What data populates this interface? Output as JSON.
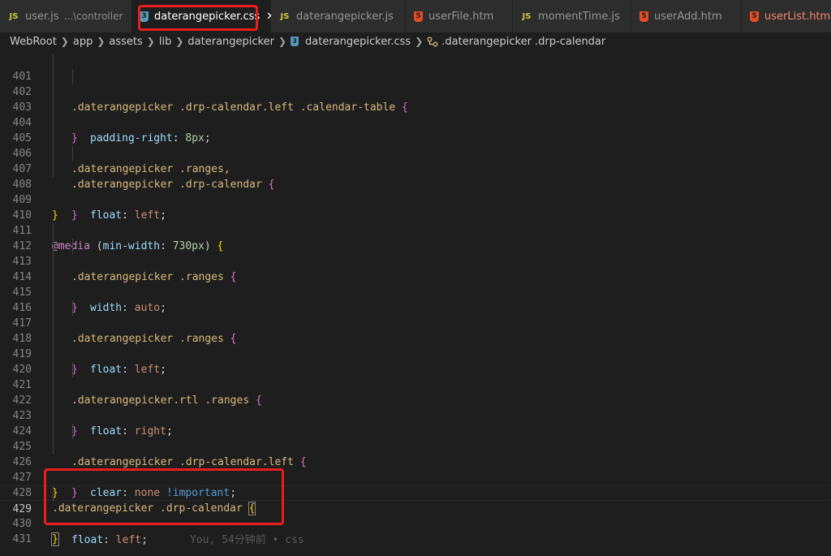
{
  "tabs": [
    {
      "icon": "JS",
      "name": "user.js",
      "desc": "...\\controller",
      "active": false
    },
    {
      "icon": "CSS",
      "name": "daterangepicker.css",
      "close": "✕",
      "active": true
    },
    {
      "icon": "JS",
      "name": "daterangepicker.js",
      "active": false
    },
    {
      "icon": "HTML",
      "name": "userFile.htm",
      "active": false
    },
    {
      "icon": "JS",
      "name": "momentTime.js",
      "active": false
    },
    {
      "icon": "HTML",
      "name": "userAdd.htm",
      "active": false
    },
    {
      "icon": "HTML",
      "name": "userList.htm",
      "active": false,
      "error": true
    }
  ],
  "breadcrumb": [
    "WebRoot",
    "app",
    "assets",
    "lib",
    "daterangepicker",
    "daterangepicker.css",
    ".daterangepicker .drp-calendar"
  ],
  "editor": {
    "line_numbers": [
      "401",
      "402",
      "403",
      "404",
      "405",
      "406",
      "407",
      "408",
      "409",
      "410",
      "411",
      "412",
      "413",
      "414",
      "415",
      "416",
      "417",
      "418",
      "419",
      "420",
      "421",
      "422",
      "423",
      "424",
      "425",
      "426",
      "427",
      "428",
      "429",
      "430",
      "431"
    ],
    "current_line": "429",
    "blame": "You, 54分钟前 • css",
    "tokens": {
      "sel_drp_left_table": ".daterangepicker .drp-calendar.left .calendar-table",
      "sel_ranges_comma": ".daterangepicker .ranges,",
      "sel_drp_calendar": ".daterangepicker .drp-calendar",
      "sel_ranges": ".daterangepicker .ranges",
      "sel_rtl_ranges": ".daterangepicker.rtl .ranges",
      "sel_drp_left": ".daterangepicker .drp-calendar.left",
      "prop_padding_right": "padding-right",
      "prop_float": "float",
      "prop_width": "width",
      "prop_clear": "clear",
      "prop_min_width": "min-width",
      "val_8px": "8px",
      "val_730px": "730px",
      "val_left": "left",
      "val_auto": "auto",
      "val_right": "right",
      "val_none": "none",
      "kw_media": "@media",
      "kw_important": "!important",
      "colon": ":",
      "semicolon": ";",
      "open_brace": "{",
      "close_brace": "}",
      "open_paren": "(",
      "close_paren": ")"
    }
  }
}
